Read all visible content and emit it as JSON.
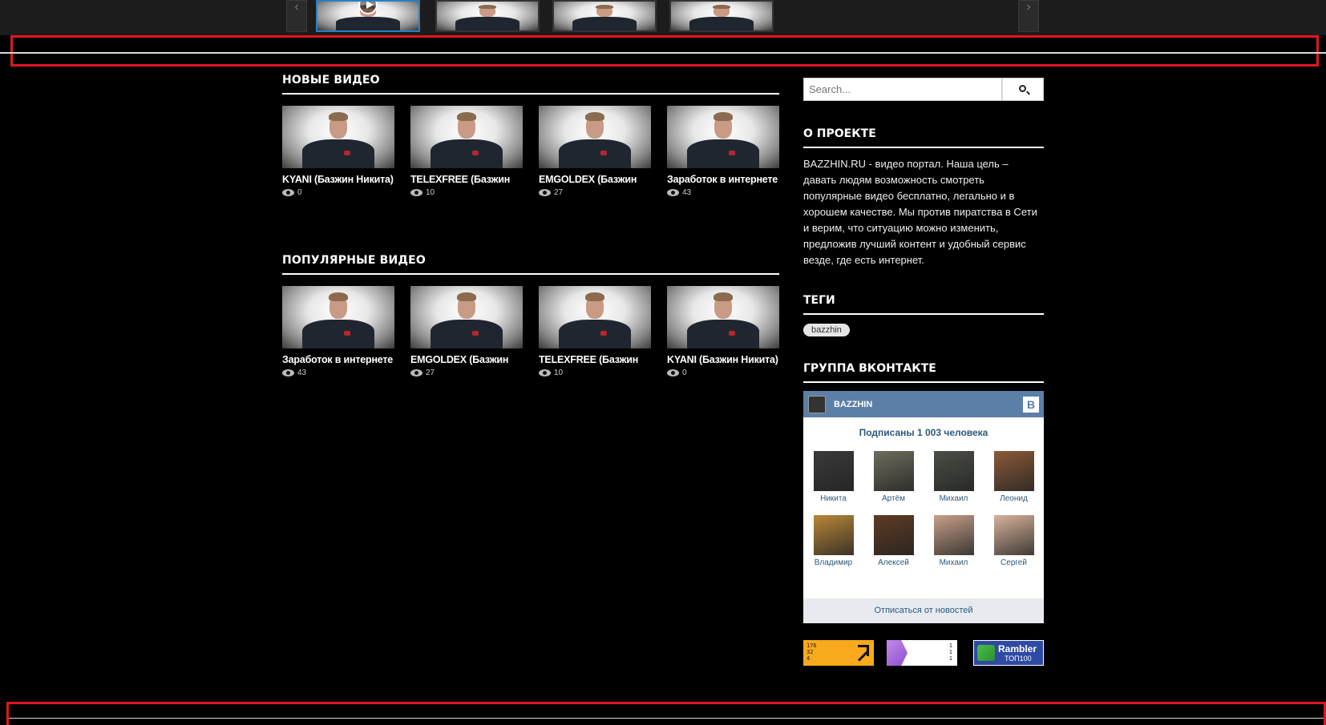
{
  "carousel": {
    "prev_label": "‹",
    "next_label": "›",
    "thumbs": [
      {
        "active": true
      },
      {
        "active": false
      },
      {
        "active": false
      },
      {
        "active": false
      }
    ]
  },
  "new_videos": {
    "title": "НОВЫЕ ВИДЕО",
    "items": [
      {
        "title": "KYANI (Базжин Никита)",
        "views": "0"
      },
      {
        "title": "TELEXFREE (Базжин",
        "views": "10"
      },
      {
        "title": "EMGOLDEX (Базжин",
        "views": "27"
      },
      {
        "title": "Заработок в интернете",
        "views": "43"
      }
    ]
  },
  "popular_videos": {
    "title": "ПОПУЛЯРНЫЕ ВИДЕО",
    "items": [
      {
        "title": "Заработок в интернете",
        "views": "43"
      },
      {
        "title": "EMGOLDEX (Базжин",
        "views": "27"
      },
      {
        "title": "TELEXFREE (Базжин",
        "views": "10"
      },
      {
        "title": "KYANI (Базжин Никита)",
        "views": "0"
      }
    ]
  },
  "search": {
    "placeholder": "Search..."
  },
  "about": {
    "title": "О ПРОЕКТЕ",
    "text": "BAZZHIN.RU - видео портал. Наша цель – давать людям возможность смотреть популярные видео бесплатно, легально и в хорошем качестве. Мы против пиратства в Сети и верим, что ситуацию можно изменить, предложив лучший контент и удобный сервис везде, где есть интернет."
  },
  "tags": {
    "title": "ТЕГИ",
    "items": [
      "bazzhin"
    ]
  },
  "vk": {
    "title": "ГРУППА ВКОНТАКТЕ",
    "group_name": "BAZZHIN",
    "badge": "В",
    "subscribers": "Подписаны 1 003 человека",
    "members": [
      {
        "name": "Никита",
        "color": "#3a3a3a"
      },
      {
        "name": "Артём",
        "color": "#6d6d5c"
      },
      {
        "name": "Михаил",
        "color": "#4a4f46"
      },
      {
        "name": "Леонид",
        "color": "#8a5a38"
      },
      {
        "name": "Владимир",
        "color": "#b9873a"
      },
      {
        "name": "Алексей",
        "color": "#5e3b22"
      },
      {
        "name": "Михаил",
        "color": "#c7a08a"
      },
      {
        "name": "Сергей",
        "color": "#d7b39b"
      }
    ],
    "unsubscribe": "Отписаться от новостей"
  },
  "counters": {
    "liveinternet": [
      "176",
      "32",
      "4"
    ],
    "yandex": [
      "1",
      "1",
      "1"
    ],
    "rambler": {
      "name": "Rambler",
      "sub": "ТОП100"
    }
  },
  "colors": {
    "highlight": "#e0161d",
    "accent": "#2a7fbf",
    "vk_header": "#5b7fa6"
  }
}
